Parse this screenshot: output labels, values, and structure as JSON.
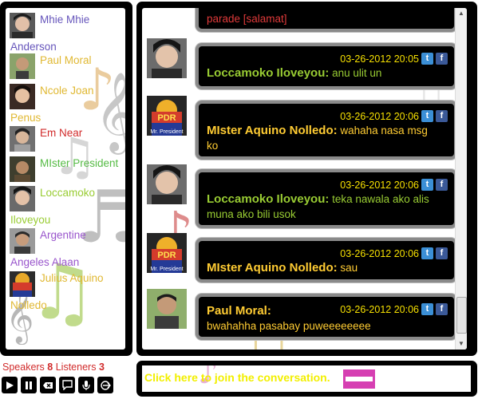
{
  "users": [
    {
      "line1": "Mhie Mhie",
      "line2": "Anderson",
      "color": "#6655bb"
    },
    {
      "line1": "Paul Moral",
      "line2": "",
      "color": "#e0b832"
    },
    {
      "line1": "Ncole Joan",
      "line2": "Penus",
      "color": "#e0b832"
    },
    {
      "line1": "Em Near",
      "line2": "",
      "color": "#d12b2b"
    },
    {
      "line1": "MIster President",
      "line2": "",
      "color": "#55bb44"
    },
    {
      "line1": "Loccamoko",
      "line2": "Iloveyou",
      "color": "#99cc33"
    },
    {
      "line1": "Argentine",
      "line2": "Angeles Alaan",
      "color": "#9955cc"
    },
    {
      "line1": "Julius Aquino",
      "line2": "Nolledo",
      "color": "#e0b832"
    }
  ],
  "chat": {
    "partial_message": "parade [salamat]",
    "messages": [
      {
        "date": "03-26-2012 20:05",
        "name": "Loccamoko Iloveyou:",
        "text": "anu ulit un"
      },
      {
        "date": "03-26-2012 20:06",
        "name": "MIster Aquino Nolledo:",
        "text": "wahaha nasa msg ko"
      },
      {
        "date": "03-26-2012 20:06",
        "name": "Loccamoko Iloveyou:",
        "text": "teka nawala ako alis muna ako bili usok"
      },
      {
        "date": "03-26-2012 20:06",
        "name": "MIster Aquino Nolledo:",
        "text": "sau"
      },
      {
        "date": "03-26-2012 20:06",
        "name": "Paul Moral:",
        "text": "bwahahha pasabay puweeeeeeee"
      }
    ],
    "avatar_badge_text": "PDR",
    "avatar_badge_caption": "Mr. President"
  },
  "stats": {
    "speakers_label": "Speakers",
    "speakers_count": "8",
    "listeners_label": "Listeners",
    "listeners_count": "3"
  },
  "controls": [
    "play-icon",
    "pause-icon",
    "delete-icon",
    "chat-icon",
    "microphone-icon",
    "exit-icon"
  ],
  "join": {
    "label": "Click here to join the conversation."
  },
  "colors": {
    "accent_yellow": "#ffcc33",
    "accent_green": "#99cc33",
    "stats_red": "#d12b2b",
    "join_magenta": "#d63fb2"
  }
}
